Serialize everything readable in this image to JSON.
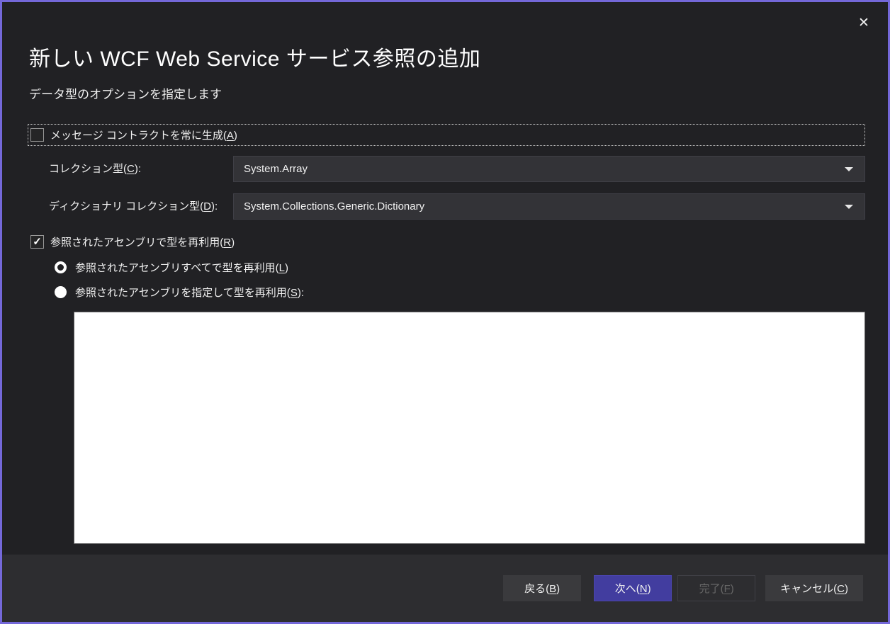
{
  "window": {
    "close_icon": "✕"
  },
  "header": {
    "title": "新しい WCF Web Service サービス参照の追加",
    "subtitle": "データ型のオプションを指定します"
  },
  "form": {
    "message_contract": {
      "pre": "メッセージ コントラクトを常に生成(",
      "key": "A",
      "post": ")",
      "checked": false
    },
    "collection_type": {
      "pre": "コレクション型(",
      "key": "C",
      "post": "):",
      "value": "System.Array"
    },
    "dictionary_type": {
      "pre": "ディクショナリ コレクション型(",
      "key": "D",
      "post": "):",
      "value": "System.Collections.Generic.Dictionary"
    },
    "reuse_types": {
      "pre": "参照されたアセンブリで型を再利用(",
      "key": "R",
      "post": ")",
      "checked": true,
      "check_glyph": "✓"
    },
    "reuse_all": {
      "pre": "参照されたアセンブリすべてで型を再利用(",
      "key": "L",
      "post": ")",
      "selected": true
    },
    "reuse_specified": {
      "pre": "参照されたアセンブリを指定して型を再利用(",
      "key": "S",
      "post": "):",
      "selected": false
    },
    "assembly_list": {
      "items": []
    }
  },
  "footer": {
    "back": {
      "pre": "戻る(",
      "key": "B",
      "post": ")",
      "enabled": true
    },
    "next": {
      "pre": "次へ(",
      "key": "N",
      "post": ")",
      "enabled": true,
      "primary": true
    },
    "finish": {
      "pre": "完了(",
      "key": "F",
      "post": ")",
      "enabled": false
    },
    "cancel": {
      "pre": "キャンセル(",
      "key": "C",
      "post": ")",
      "enabled": true
    }
  },
  "colors": {
    "accent_border": "#7468d9",
    "dialog_bg": "#212124",
    "footer_bg": "#2d2d30",
    "combo_bg": "#333337",
    "primary_button_bg": "#423d9f",
    "button_bg": "#3a3a3d",
    "text": "#f1f1f1",
    "disabled_text": "#686868",
    "list_bg": "#ffffff"
  }
}
